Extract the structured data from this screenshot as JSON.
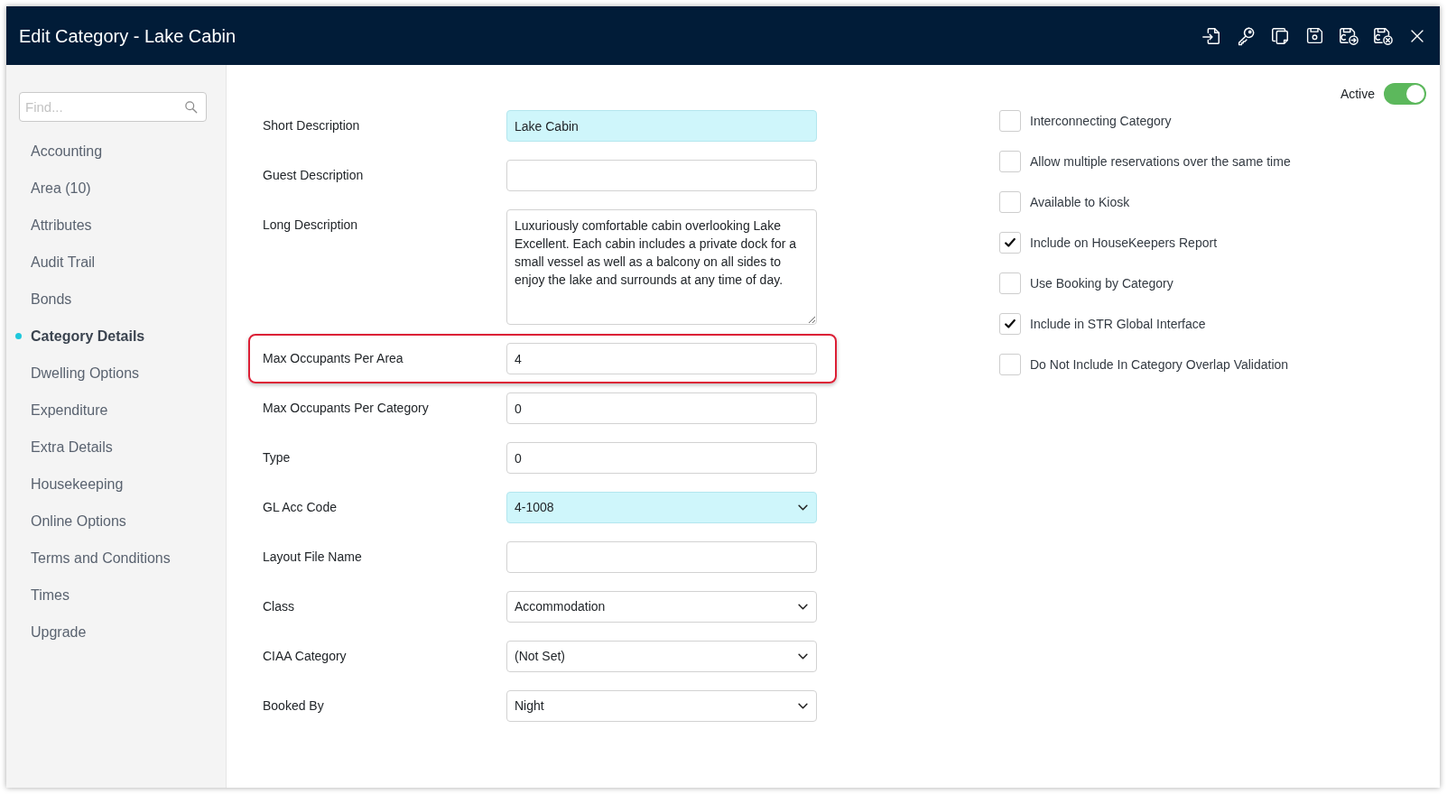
{
  "window": {
    "title": "Edit Category - Lake Cabin"
  },
  "sidebar": {
    "search": {
      "placeholder": "Find..."
    },
    "items": [
      {
        "label": "Accounting",
        "selected": false
      },
      {
        "label": "Area (10)",
        "selected": false
      },
      {
        "label": "Attributes",
        "selected": false
      },
      {
        "label": "Audit Trail",
        "selected": false
      },
      {
        "label": "Bonds",
        "selected": false
      },
      {
        "label": "Category Details",
        "selected": true
      },
      {
        "label": "Dwelling Options",
        "selected": false
      },
      {
        "label": "Expenditure",
        "selected": false
      },
      {
        "label": "Extra Details",
        "selected": false
      },
      {
        "label": "Housekeeping",
        "selected": false
      },
      {
        "label": "Online Options",
        "selected": false
      },
      {
        "label": "Terms and Conditions",
        "selected": false
      },
      {
        "label": "Times",
        "selected": false
      },
      {
        "label": "Upgrade",
        "selected": false
      }
    ]
  },
  "form": {
    "fields": [
      {
        "label": "Short Description",
        "kind": "text",
        "value": "Lake Cabin",
        "highlighted": true,
        "outlined": false
      },
      {
        "label": "Guest Description",
        "kind": "text",
        "highlighted": false,
        "outlined": false
      },
      {
        "label": "Long Description",
        "kind": "textarea",
        "value": "Luxuriously comfortable cabin overlooking Lake Excellent. Each cabin includes a private dock for a small vessel as well as a balcony on all sides to enjoy the lake and surrounds at any time of day.",
        "highlighted": false,
        "outlined": false
      },
      {
        "label": "Max Occupants Per Area",
        "kind": "text",
        "value": "4",
        "highlighted": false,
        "outlined": true
      },
      {
        "label": "Max Occupants Per Category",
        "kind": "text",
        "value": "0",
        "highlighted": false,
        "outlined": false
      },
      {
        "label": "Type",
        "kind": "text",
        "value": "0",
        "highlighted": false,
        "outlined": false
      },
      {
        "label": "GL Acc Code",
        "kind": "select",
        "value": "4-1008",
        "highlighted": true,
        "outlined": false
      },
      {
        "label": "Layout File Name",
        "kind": "text",
        "highlighted": false,
        "outlined": false
      },
      {
        "label": "Class",
        "kind": "select",
        "value": "Accommodation",
        "highlighted": false,
        "outlined": false
      },
      {
        "label": "CIAA Category",
        "kind": "select",
        "value": "(Not Set)",
        "highlighted": false,
        "outlined": false
      },
      {
        "label": "Booked By",
        "kind": "select",
        "value": "Night",
        "highlighted": false,
        "outlined": false
      }
    ]
  },
  "options": {
    "active": {
      "label": "Active",
      "on": true
    },
    "checkboxes": [
      {
        "label": "Interconnecting Category",
        "checked": false
      },
      {
        "label": "Allow multiple reservations over the same time",
        "checked": false
      },
      {
        "label": "Available to Kiosk",
        "checked": false
      },
      {
        "label": "Include on HouseKeepers Report",
        "checked": true
      },
      {
        "label": "Use Booking by Category",
        "checked": false
      },
      {
        "label": "Include in STR Global Interface",
        "checked": true
      },
      {
        "label": "Do Not Include In Category Overlap Validation",
        "checked": false
      }
    ]
  }
}
